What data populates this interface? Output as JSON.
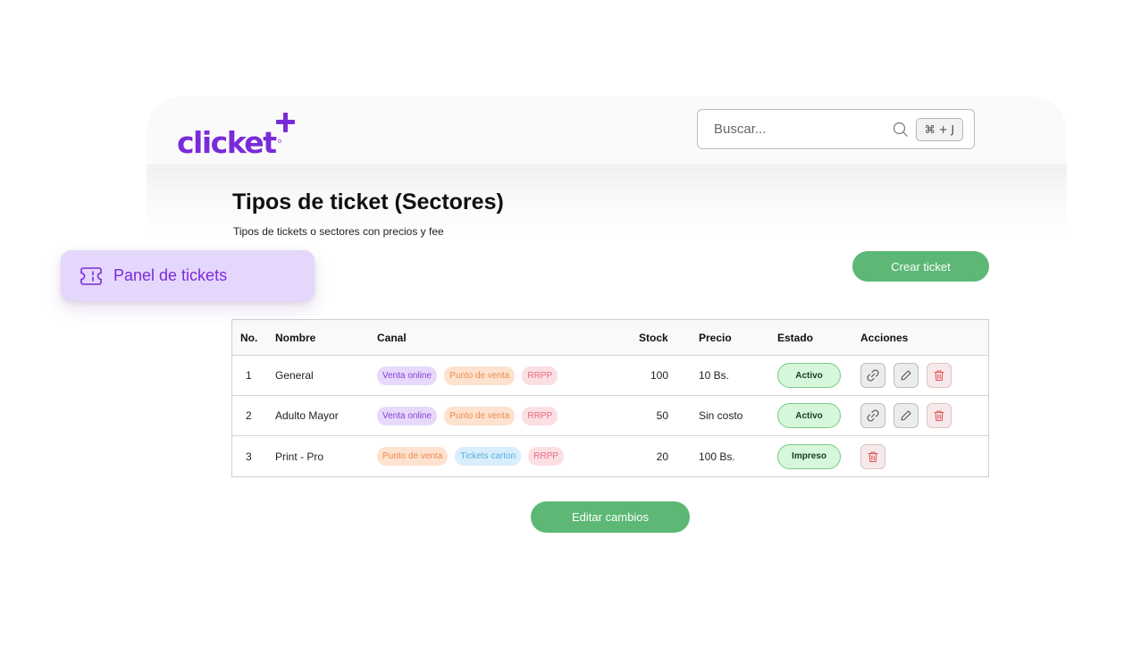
{
  "brand": {
    "name": "clicket",
    "color": "#7a2bd9"
  },
  "search": {
    "placeholder": "Buscar...",
    "shortcut": "⌘ + J"
  },
  "page": {
    "title": "Tipos de ticket (Sectores)",
    "subtitle": "Tipos de tickets o sectores con precios y fee"
  },
  "actions": {
    "create": "Crear ticket",
    "edit": "Editar cambios"
  },
  "sidebar": {
    "active_item": "Panel de tickets",
    "active_icon": "ticket-icon"
  },
  "table": {
    "headers": {
      "no": "No.",
      "nombre": "Nombre",
      "canal": "Canal",
      "stock": "Stock",
      "precio": "Precio",
      "estado": "Estado",
      "acciones": "Acciones"
    },
    "rows": [
      {
        "no": "1",
        "nombre": "General",
        "canales": [
          "Venta online",
          "Punto de venta",
          "RRPP"
        ],
        "stock": "100",
        "precio": "10 Bs.",
        "estado": "Activo"
      },
      {
        "no": "2",
        "nombre": "Adulto Mayor",
        "canales": [
          "Venta online",
          "Punto de venta",
          "RRPP"
        ],
        "stock": "50",
        "precio": "Sin costo",
        "estado": "Activo"
      },
      {
        "no": "3",
        "nombre": "Print - Pro",
        "canales": [
          "Punto de venta",
          "Tickets carton",
          "RRPP"
        ],
        "stock": "20",
        "precio": "100 Bs.",
        "estado": "Impreso"
      }
    ]
  },
  "colors": {
    "primary_green": "#5cb874",
    "status_bg": "#d6f7d9",
    "delete_red": "#e0565b"
  }
}
